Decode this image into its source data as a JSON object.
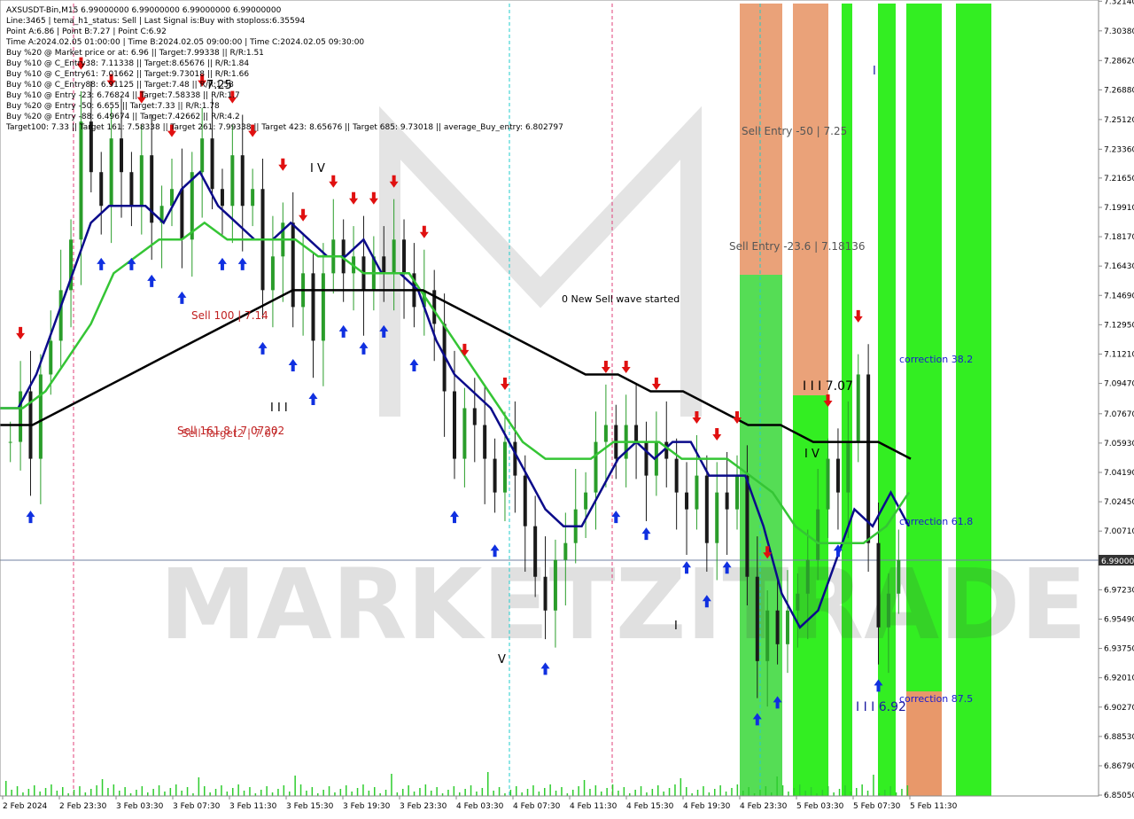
{
  "info": {
    "lines": [
      "AXSUSDT-Bin,M15  6.99000000 6.99000000 6.99000000 6.99000000",
      "Line:3465 | tema_h1_status: Sell | Last Signal is:Buy with stoploss:6.35594",
      "Point A:6.86 | Point B:7.27 | Point C:6.92",
      "Time A:2024.02.05 01:00:00 | Time B:2024.02.05 09:00:00 | Time C:2024.02.05 09:30:00",
      "Buy %20 @ Market price or at: 6.96 || Target:7.99338 || R/R:1.51",
      "Buy %10 @ C_Entry38: 7.11338 || Target:8.65676 || R/R:1.84",
      "Buy %10 @ C_Entry61: 7.01662 || Target:9.73018 || R/R:1.66",
      "Buy %10 @ C_Entry88: 6.91125 || Target:7.48 || R/R:1.58",
      "Buy %10 @ Entry -23: 6.76824 || Target:7.58338 || R/R:1.7",
      "Buy %20 @ Entry -50: 6.655 || Target:7.33 || R/R:1.78",
      "Buy %20 @ Entry -88: 6.49674 || Target:7.42662 || R/R:4.2",
      "Target100: 7.33 || Target 161: 7.58338 || Target 261: 7.99338 || Target 423: 8.65676 || Target 685: 9.73018 || average_Buy_entry: 6.802797"
    ]
  },
  "chart_data": {
    "type": "candlestick",
    "symbol": "AXSUSDT-Bin",
    "timeframe": "M15",
    "ylim": [
      6.85,
      7.32
    ],
    "y_ticks": [
      "7.32140",
      "7.30380",
      "7.28620",
      "7.26880",
      "7.25120",
      "7.23360",
      "7.21650",
      "7.19910",
      "7.18170",
      "7.16430",
      "7.14690",
      "7.12950",
      "7.11210",
      "7.09470",
      "7.07670",
      "7.05930",
      "7.04190",
      "7.02450",
      "7.00710",
      "6.99000",
      "6.97230",
      "6.95490",
      "6.93750",
      "6.92010",
      "6.90270",
      "6.88530",
      "6.86790",
      "6.85050"
    ],
    "x_ticks": [
      "2 Feb 2024",
      "2 Feb 23:30",
      "3 Feb 03:30",
      "3 Feb 07:30",
      "3 Feb 11:30",
      "3 Feb 15:30",
      "3 Feb 19:30",
      "3 Feb 23:30",
      "4 Feb 03:30",
      "4 Feb 07:30",
      "4 Feb 11:30",
      "4 Feb 15:30",
      "4 Feb 19:30",
      "4 Feb 23:30",
      "5 Feb 03:30",
      "5 Feb 07:30",
      "5 Feb 11:30"
    ],
    "current_price": "6.99000",
    "close_series": [
      7.06,
      7.09,
      7.05,
      7.1,
      7.12,
      7.15,
      7.18,
      7.25,
      7.22,
      7.2,
      7.24,
      7.22,
      7.2,
      7.23,
      7.19,
      7.2,
      7.21,
      7.18,
      7.22,
      7.24,
      7.21,
      7.2,
      7.23,
      7.2,
      7.21,
      7.15,
      7.17,
      7.19,
      7.14,
      7.16,
      7.12,
      7.16,
      7.18,
      7.16,
      7.17,
      7.15,
      7.17,
      7.16,
      7.18,
      7.16,
      7.14,
      7.15,
      7.13,
      7.09,
      7.05,
      7.08,
      7.07,
      7.05,
      7.03,
      7.06,
      7.04,
      7.01,
      6.98,
      6.96,
      6.99,
      7.0,
      7.02,
      7.03,
      7.06,
      7.07,
      7.05,
      7.07,
      7.06,
      7.04,
      7.06,
      7.05,
      7.03,
      7.02,
      7.04,
      7.0,
      7.03,
      7.02,
      7.04,
      6.98,
      6.93,
      6.96,
      6.94,
      6.96,
      6.97,
      6.99,
      7.02,
      7.05,
      7.03,
      7.06,
      7.1,
      7.0,
      6.95,
      6.97,
      6.99
    ],
    "series": [
      {
        "name": "",
        "color": "#0b0b8a",
        "values": [
          7.08,
          7.08,
          7.1,
          7.13,
          7.16,
          7.19,
          7.2,
          7.2,
          7.2,
          7.19,
          7.21,
          7.22,
          7.2,
          7.19,
          7.18,
          7.18,
          7.19,
          7.18,
          7.17,
          7.17,
          7.18,
          7.16,
          7.16,
          7.15,
          7.12,
          7.1,
          7.09,
          7.08,
          7.06,
          7.04,
          7.02,
          7.01,
          7.01,
          7.03,
          7.05,
          7.06,
          7.05,
          7.06,
          7.06,
          7.04,
          7.04,
          7.04,
          7.01,
          6.97,
          6.95,
          6.96,
          6.99,
          7.02,
          7.01,
          7.03,
          7.01
        ]
      },
      {
        "name": "",
        "color": "#35c535",
        "values": [
          7.08,
          7.08,
          7.09,
          7.11,
          7.13,
          7.16,
          7.17,
          7.18,
          7.18,
          7.19,
          7.18,
          7.18,
          7.18,
          7.18,
          7.17,
          7.17,
          7.16,
          7.16,
          7.16,
          7.14,
          7.12,
          7.1,
          7.08,
          7.06,
          7.05,
          7.05,
          7.05,
          7.06,
          7.06,
          7.06,
          7.05,
          7.05,
          7.05,
          7.04,
          7.03,
          7.01,
          7.0,
          7.0,
          7.0,
          7.01,
          7.03
        ]
      },
      {
        "name": "",
        "color": "#000000",
        "values": [
          7.07,
          7.07,
          7.08,
          7.09,
          7.1,
          7.11,
          7.12,
          7.13,
          7.14,
          7.15,
          7.15,
          7.15,
          7.15,
          7.15,
          7.14,
          7.13,
          7.12,
          7.11,
          7.1,
          7.1,
          7.09,
          7.09,
          7.08,
          7.07,
          7.07,
          7.06,
          7.06,
          7.06,
          7.05
        ]
      }
    ]
  },
  "zones": {
    "orange": "#e8986a",
    "green_light": "#55dd55",
    "green_bright": "#33ee22"
  },
  "annotations": {
    "sell_entry_50": "Sell Entry -50 | 7.25",
    "sell_entry_23": "Sell Entry -23.6 | 7.18136",
    "new_sell_wave": "0 New Sell wave started",
    "new_sell_wave_top": "0 New Sell wave started",
    "sell_100": "Sell 100 | 7.14",
    "sell_161": "Sell 161.8 | 7.07202",
    "sell_target2": "Sell Target2 | 7.07",
    "wave_7_25": "7.25",
    "wave_iv": "I V",
    "wave_iii_left": "I I I",
    "wave_v": "V",
    "wave_iii_707": "I I I 7.07",
    "wave_iv_right": "I V",
    "wave_i_top": "I",
    "wave_i_low": "I",
    "wave_iii_692": "I I I 6.92",
    "correction_382": "correction 38.2",
    "correction_618": "correction 61.8",
    "correction_875": "correction 87.5",
    "watermark": "MARKETZITRADE"
  }
}
